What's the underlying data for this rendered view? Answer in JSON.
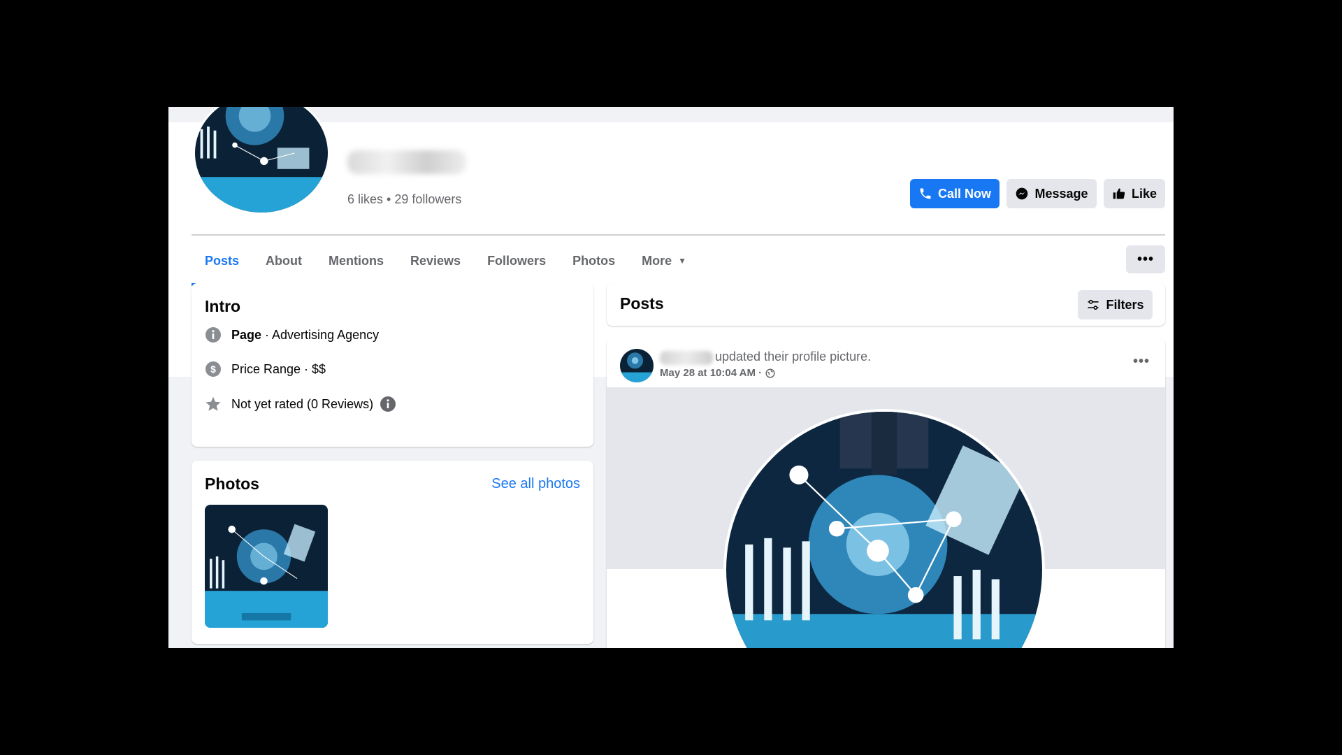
{
  "page": {
    "stats": "6 likes • 29 followers"
  },
  "actions": {
    "call_label": "Call Now",
    "message_label": "Message",
    "like_label": "Like"
  },
  "tabs": [
    {
      "label": "Posts",
      "active": true
    },
    {
      "label": "About"
    },
    {
      "label": "Mentions"
    },
    {
      "label": "Reviews"
    },
    {
      "label": "Followers"
    },
    {
      "label": "Photos"
    },
    {
      "label": "More"
    }
  ],
  "tab_menu_label": "•••",
  "intro": {
    "title": "Intro",
    "page_label": "Page",
    "page_category": " · Advertising Agency",
    "price_range": "Price Range · $$",
    "rating": "Not yet rated (0 Reviews)"
  },
  "photos": {
    "title": "Photos",
    "see_all": "See all photos"
  },
  "posts": {
    "title": "Posts",
    "filters_label": "Filters",
    "post": {
      "action_text": "updated their profile picture.",
      "timestamp": "May 28 at 10:04 AM ·",
      "menu_label": "•••"
    }
  },
  "colors": {
    "accent": "#1877f2",
    "secondary_button": "#e4e6eb",
    "page_bg": "#f0f2f5",
    "muted_text": "#65676b"
  }
}
